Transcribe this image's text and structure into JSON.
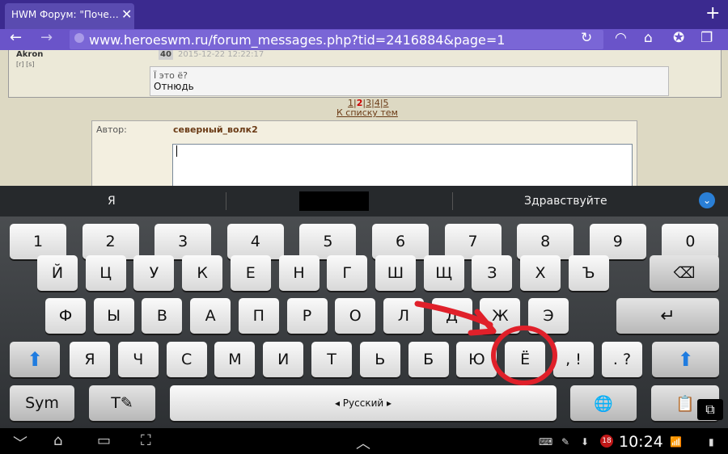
{
  "browser": {
    "tab_title": "HWM Форум: \"Поче…",
    "close_symbol": "✕",
    "new_tab_symbol": "+",
    "url": "www.heroeswm.ru/forum_messages.php?tid=2416884&page=1",
    "icons": [
      "back-icon",
      "forward-icon",
      "reload-icon",
      "quick-controls-icon",
      "home-icon",
      "bookmarks-icon",
      "tabs-icon"
    ]
  },
  "page": {
    "post": {
      "author": "Akron",
      "author_icons": "[r] [s]",
      "number": "40",
      "date": "2015-12-22 12:22:17",
      "quote": "Ї это ё?",
      "reply": "Отнюдь"
    },
    "pager": {
      "pages": [
        "1",
        "2",
        "3",
        "4",
        "5"
      ],
      "current": "2",
      "separator": "|"
    },
    "to_list": "К списку тем",
    "form": {
      "author_label": "Автор:",
      "author_name": "северный_волк2"
    }
  },
  "keyboard": {
    "suggestions": [
      "Я",
      "Здравствуйте"
    ],
    "number_row": [
      "1",
      "2",
      "3",
      "4",
      "5",
      "6",
      "7",
      "8",
      "9",
      "0"
    ],
    "row1": [
      "Й",
      "Ц",
      "У",
      "К",
      "Е",
      "Н",
      "Г",
      "Ш",
      "Щ",
      "З",
      "Х",
      "Ъ"
    ],
    "row2": [
      "Ф",
      "Ы",
      "В",
      "А",
      "П",
      "Р",
      "О",
      "Л",
      "Д",
      "Ж",
      "Э"
    ],
    "row3": [
      "Я",
      "Ч",
      "С",
      "М",
      "И",
      "Т",
      "Ь",
      "Б",
      "Ю",
      "Ё"
    ],
    "punct_comma": ", !",
    "punct_period": ". ?",
    "sym_label": "Sym",
    "language_label": "◂ Русский ▸",
    "icons": [
      "backspace-icon",
      "enter-icon",
      "shift-icon",
      "text-edit-icon",
      "globe-icon",
      "clipboard-icon"
    ]
  },
  "annotation": {
    "color": "#e0202a"
  },
  "status": {
    "time": "10:24",
    "notification_count": "18"
  }
}
